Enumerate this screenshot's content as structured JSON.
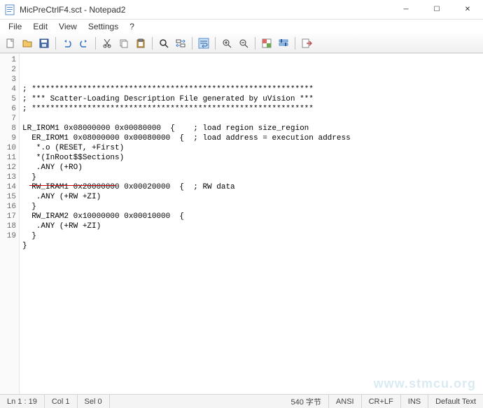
{
  "title": "MicPreCtrlF4.sct - Notepad2",
  "menus": [
    "File",
    "Edit",
    "View",
    "Settings",
    "?"
  ],
  "toolbar_icons": [
    "new-file-icon",
    "open-file-icon",
    "save-icon",
    "sep",
    "undo-icon",
    "redo-icon",
    "sep",
    "cut-icon",
    "copy-icon",
    "paste-icon",
    "sep",
    "find-icon",
    "replace-icon",
    "sep",
    "word-wrap-icon",
    "sep",
    "zoom-in-icon",
    "zoom-out-icon",
    "sep",
    "scheme-icon",
    "customize-icon",
    "sep",
    "exit-icon"
  ],
  "code_lines": [
    "; *************************************************************",
    "; *** Scatter-Loading Description File generated by uVision ***",
    "; *************************************************************",
    "",
    "LR_IROM1 0x08000000 0x00080000  {    ; load region size_region",
    "  ER_IROM1 0x08000000 0x00080000  {  ; load address = execution address",
    "   *.o (RESET, +First)",
    "   *(InRoot$$Sections)",
    "   .ANY (+RO)",
    "  }",
    "  RW_IRAM1 0x20000000 0x00020000  {  ; RW data",
    "   .ANY (+RW +ZI)",
    "  }",
    "  RW_IRAM2 0x10000000 0x00010000  {",
    "   .ANY (+RW +ZI)",
    "  }",
    "}",
    "",
    ""
  ],
  "status": {
    "pos": "Ln 1 : 19",
    "col": "Col 1",
    "sel": "Sel 0",
    "bytes": "540 字节",
    "enc": "ANSI",
    "eol": "CR+LF",
    "ins": "INS",
    "lexer": "Default Text"
  },
  "watermark": "www.stmcu.org"
}
